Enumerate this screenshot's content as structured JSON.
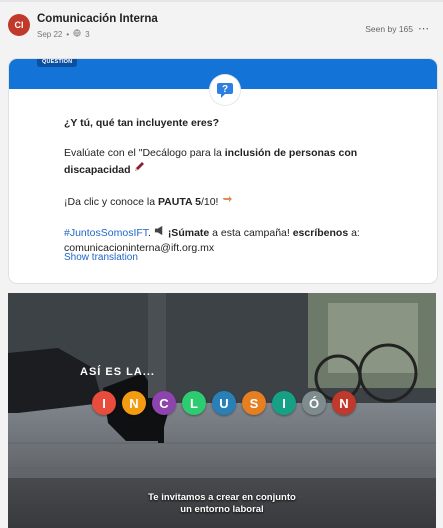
{
  "post": {
    "avatar_initials": "CI",
    "author": "Comunicación Interna",
    "date": "Sep 22",
    "separator": "•",
    "scope_icon": "globe-icon",
    "scope_count": "3",
    "seen_by": "Seen by 165",
    "more_icon": "more-options-icon"
  },
  "question_card": {
    "badge": "QUESTION",
    "banner_color": "#1473d6",
    "title": "¿Y tú, qué tan incluyente eres?",
    "p2_prefix": "Evalúate con el \"Decálogo para la ",
    "p2_bold": "inclusión de personas con discapacidad",
    "p2_emoji": "pencil-icon",
    "p3_prefix": "¡Da clic y conoce la ",
    "p3_bold": "PAUTA 5",
    "p3_suffix": "/10!",
    "p3_emoji": "pointing-hand-icon",
    "hashtag": "#JuntosSomosIFT",
    "p4_after_hashtag": ".",
    "p4_emoji": "megaphone-icon",
    "p4_bold1": "¡Súmate",
    "p4_mid": " a esta campaña! ",
    "p4_bold2": "escríbenos",
    "p4_end": " a:",
    "email": "comunicacioninterna@ift.org.mx",
    "show_translation": "Show translation"
  },
  "video": {
    "overlay_title": "ASÍ ES LA...",
    "letters": [
      {
        "char": "I",
        "color": "#e74c3c"
      },
      {
        "char": "N",
        "color": "#f39c12"
      },
      {
        "char": "C",
        "color": "#8e44ad"
      },
      {
        "char": "L",
        "color": "#2ecc71"
      },
      {
        "char": "U",
        "color": "#2980b9"
      },
      {
        "char": "S",
        "color": "#e67e22"
      },
      {
        "char": "I",
        "color": "#16a085"
      },
      {
        "char": "Ó",
        "color": "#7f8c8d"
      },
      {
        "char": "N",
        "color": "#c0392b"
      }
    ],
    "caption_line1": "Te invitamos a crear en conjunto",
    "caption_line2": "un entorno laboral"
  }
}
